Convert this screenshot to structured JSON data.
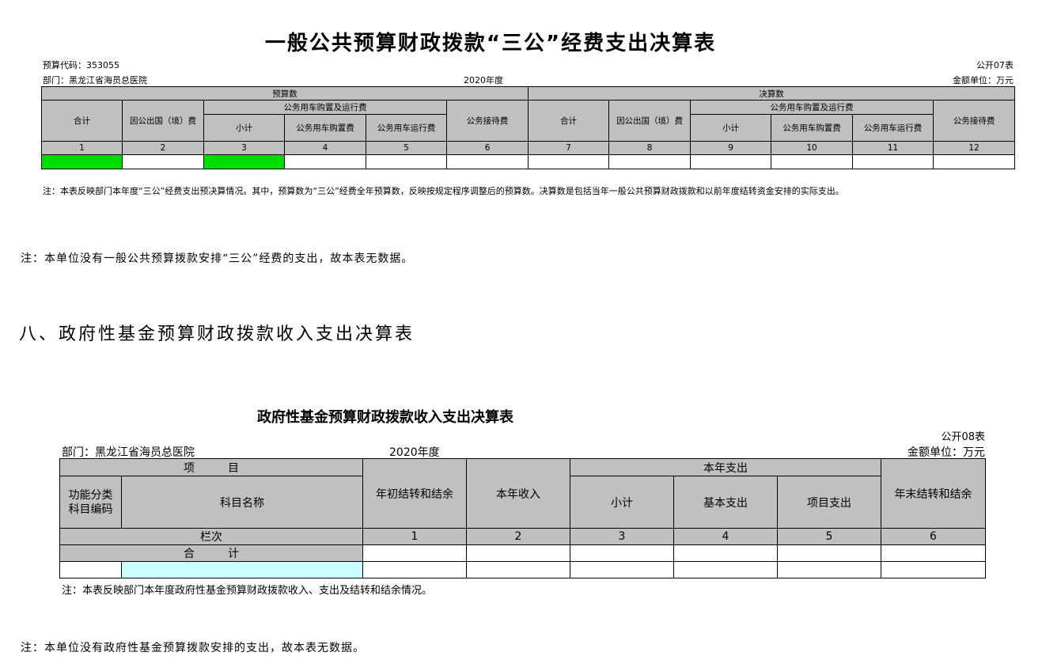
{
  "table1": {
    "title": "一般公共预算财政拨款“三公”经费支出决算表",
    "budget_code": "预算代码：353055",
    "dept": "部门：黑龙江省海员总医院",
    "year": "2020年度",
    "table_no": "公开07表",
    "unit": "金额单位：万元",
    "group_budget": "预算数",
    "group_final": "决算数",
    "headers": {
      "total": "合计",
      "abroad": "因公出国（境）费",
      "vehicle_group": "公务用车购置及运行费",
      "subtotal": "小计",
      "vehicle_purchase": "公务用车购置费",
      "vehicle_run": "公务用车运行费",
      "reception": "公务接待费"
    },
    "col_numbers": [
      "1",
      "2",
      "3",
      "4",
      "5",
      "6",
      "7",
      "8",
      "9",
      "10",
      "11",
      "12"
    ],
    "note": "注：本表反映部门本年度“三公”经费支出预决算情况。其中，预算数为“三公”经费全年预算数，反映按规定程序调整后的预算数。决算数是包括当年一般公共预算财政拨款和以前年度结转资金安排的实际支出。"
  },
  "note1": "注：本单位没有一般公共预算拨款安排“三公”经费的支出，故本表无数据。",
  "section_heading": "八、政府性基金预算财政拨款收入支出决算表",
  "table2": {
    "title": "政府性基金预算财政拨款收入支出决算表",
    "table_no": "公开08表",
    "dept": "部门：黑龙江省海员总医院",
    "year": "2020年度",
    "unit": "金额单位：万元",
    "headers": {
      "item": "项　　　目",
      "func_code": "功能分类科目编码",
      "subject_name": "科目名称",
      "begin_balance": "年初结转和结余",
      "income": "本年收入",
      "expense_group": "本年支出",
      "subtotal": "小计",
      "basic": "基本支出",
      "project": "项目支出",
      "end_balance": "年末结转和结余"
    },
    "row_index_label": "栏次",
    "col_numbers": [
      "1",
      "2",
      "3",
      "4",
      "5",
      "6"
    ],
    "total_label": "合　　　计",
    "note": "注：本表反映部门本年度政府性基金预算财政拨款收入、支出及结转和结余情况。"
  },
  "note2": "注：本单位没有政府性基金预算拨款安排的支出，故本表无数据。"
}
